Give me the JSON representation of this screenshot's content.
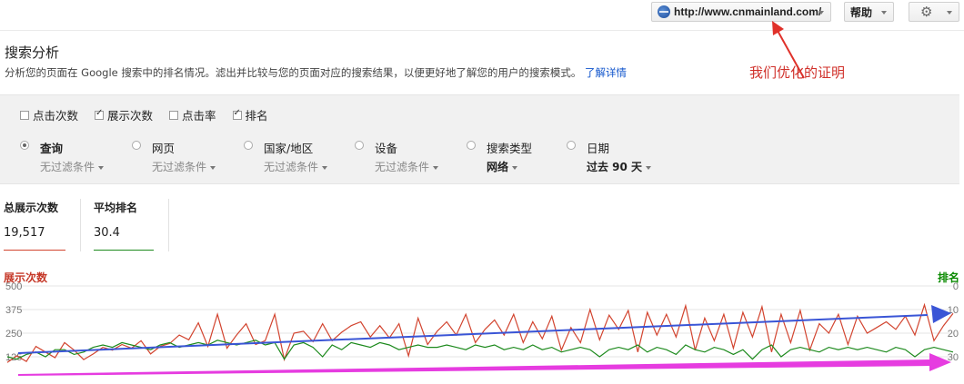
{
  "topbar": {
    "site": "http://www.cnmainland.com/",
    "help": "帮助",
    "gear": "⚙"
  },
  "page": {
    "title": "搜索分析",
    "description": "分析您的页面在 Google 搜索中的排名情况。滤出并比较与您的页面对应的搜索结果，以便更好地了解您的用户的搜索模式。",
    "learn_more": "了解详情",
    "annotation": "我们优化的证明"
  },
  "metrics": [
    {
      "label": "点击次数",
      "checked": false
    },
    {
      "label": "展示次数",
      "checked": true
    },
    {
      "label": "点击率",
      "checked": false
    },
    {
      "label": "排名",
      "checked": true
    }
  ],
  "dimensions": [
    {
      "label": "查询",
      "sub": "无过滤条件",
      "selected": true
    },
    {
      "label": "网页",
      "sub": "无过滤条件",
      "selected": false
    },
    {
      "label": "国家/地区",
      "sub": "无过滤条件",
      "selected": false
    },
    {
      "label": "设备",
      "sub": "无过滤条件",
      "selected": false
    },
    {
      "label": "搜索类型",
      "sub": "网络",
      "selected": false
    },
    {
      "label": "日期",
      "sub": "过去 90 天",
      "selected": false
    }
  ],
  "stats": {
    "impressions_label": "总展示次数",
    "impressions_value": "19,517",
    "position_label": "平均排名",
    "position_value": "30.4"
  },
  "chart_data": {
    "type": "line",
    "left_axis_label": "展示次数",
    "right_axis_label": "排名",
    "left_ticks": [
      "500",
      "375",
      "250",
      "125"
    ],
    "right_ticks": [
      "0",
      "10",
      "20",
      "30"
    ],
    "ylim_left": [
      0,
      500
    ],
    "ylim_right": [
      0,
      40
    ],
    "colors": {
      "impressions": "#d2442f",
      "position": "#1d8a1d",
      "arrow_blue": "#3a55d6",
      "arrow_magenta": "#e63ce0",
      "annotation": "#d0302a"
    },
    "series": [
      {
        "name": "展示次数",
        "axis": "left",
        "values": [
          95,
          130,
          100,
          180,
          150,
          120,
          200,
          160,
          110,
          140,
          175,
          160,
          190,
          170,
          210,
          140,
          180,
          195,
          240,
          215,
          305,
          180,
          350,
          170,
          240,
          300,
          190,
          210,
          350,
          110,
          250,
          260,
          205,
          300,
          210,
          255,
          290,
          310,
          230,
          290,
          225,
          300,
          130,
          330,
          190,
          260,
          310,
          240,
          350,
          200,
          270,
          320,
          240,
          350,
          200,
          310,
          220,
          340,
          160,
          280,
          200,
          375,
          215,
          345,
          270,
          370,
          150,
          360,
          240,
          350,
          230,
          395,
          160,
          330,
          210,
          350,
          170,
          360,
          230,
          390,
          150,
          350,
          200,
          370,
          160,
          300,
          250,
          350,
          190,
          340,
          250,
          280,
          310,
          270,
          340,
          240,
          400,
          210,
          290,
          355
        ]
      },
      {
        "name": "排名",
        "axis": "right",
        "values": [
          30,
          31,
          29,
          28,
          30,
          27,
          27,
          29,
          28,
          26,
          25,
          26,
          24,
          25,
          26,
          27,
          25,
          24,
          26,
          25,
          24,
          25,
          23,
          24,
          25,
          24,
          23,
          25,
          24,
          31,
          25,
          24,
          26,
          30,
          25,
          27,
          24,
          25,
          26,
          24,
          25,
          27,
          26,
          25,
          26,
          26,
          25,
          26,
          27,
          25,
          26,
          25,
          27,
          26,
          27,
          25,
          27,
          26,
          28,
          27,
          26,
          27,
          30,
          27,
          26,
          27,
          25,
          28,
          26,
          27,
          29,
          25,
          27,
          28,
          26,
          27,
          29,
          27,
          31,
          27,
          25,
          30,
          27,
          26,
          27,
          28,
          26,
          27,
          26,
          27,
          26,
          27,
          28,
          26,
          27,
          30,
          27,
          26,
          27,
          28
        ]
      }
    ]
  }
}
